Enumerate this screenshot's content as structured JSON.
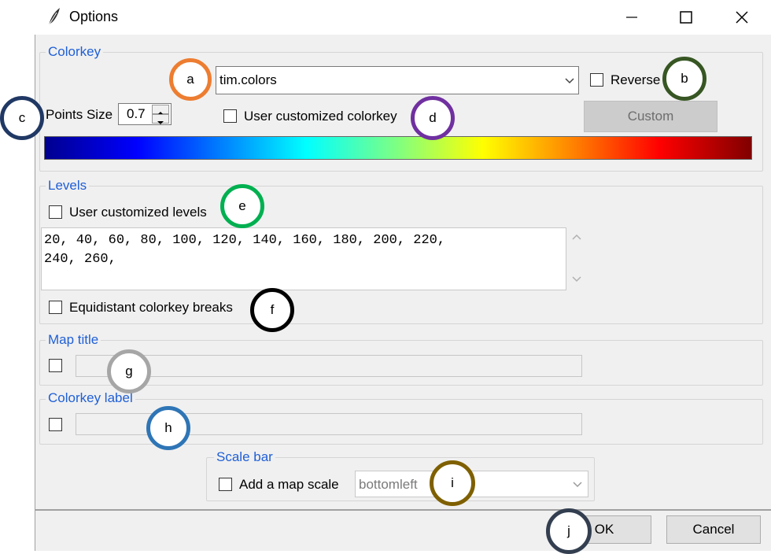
{
  "window": {
    "title": "Options",
    "minimize_icon": "minimize-icon",
    "maximize_icon": "maximize-icon",
    "close_icon": "close-icon"
  },
  "colorkey": {
    "legend": "Colorkey",
    "palette_value": "tim.colors",
    "reverse_label": "Reverse",
    "points_size_label": "Points Size",
    "points_size_value": "0.7",
    "user_custom_label": "User customized colorkey",
    "custom_button": "Custom"
  },
  "levels": {
    "legend": "Levels",
    "user_custom_label": "User customized levels",
    "text": "20, 40, 60, 80, 100, 120, 140, 160, 180, 200, 220,\n240, 260,",
    "equidistant_label": "Equidistant colorkey breaks"
  },
  "map_title": {
    "legend": "Map title",
    "value": ""
  },
  "colorkey_label": {
    "legend": "Colorkey label",
    "value": ""
  },
  "scale_bar": {
    "legend": "Scale bar",
    "add_label": "Add a map scale",
    "position_value": "bottomleft"
  },
  "buttons": {
    "ok": "OK",
    "cancel": "Cancel"
  },
  "markers": [
    {
      "letter": "a",
      "color": "#ed7d31"
    },
    {
      "letter": "b",
      "color": "#375623"
    },
    {
      "letter": "c",
      "color": "#203864"
    },
    {
      "letter": "d",
      "color": "#7030a0"
    },
    {
      "letter": "e",
      "color": "#00b050"
    },
    {
      "letter": "f",
      "color": "#000000"
    },
    {
      "letter": "g",
      "color": "#a6a6a6"
    },
    {
      "letter": "h",
      "color": "#2e75b6"
    },
    {
      "letter": "i",
      "color": "#7f6000"
    },
    {
      "letter": "j",
      "color": "#333f50"
    }
  ]
}
